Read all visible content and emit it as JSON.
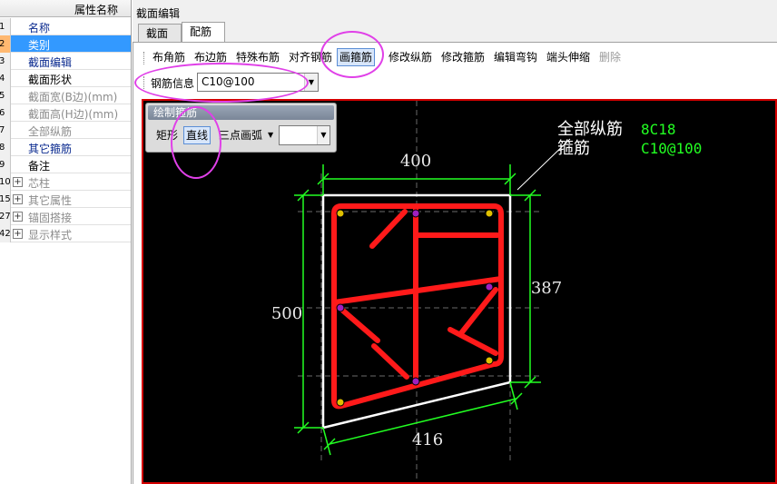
{
  "property_panel": {
    "header": "属性名称",
    "rows": [
      {
        "num": "1",
        "label": "名称",
        "color": "blue",
        "expand": false,
        "selected": false
      },
      {
        "num": "2",
        "label": "类别",
        "color": "white",
        "expand": false,
        "selected": true
      },
      {
        "num": "3",
        "label": "截面编辑",
        "color": "blue",
        "expand": false,
        "selected": false
      },
      {
        "num": "4",
        "label": "截面形状",
        "color": "black",
        "expand": false,
        "selected": false
      },
      {
        "num": "5",
        "label": "截面宽(B边)(mm)",
        "color": "gray",
        "expand": false,
        "selected": false
      },
      {
        "num": "6",
        "label": "截面高(H边)(mm)",
        "color": "gray",
        "expand": false,
        "selected": false
      },
      {
        "num": "7",
        "label": "全部纵筋",
        "color": "gray",
        "expand": false,
        "selected": false
      },
      {
        "num": "8",
        "label": "其它箍筋",
        "color": "blue",
        "expand": false,
        "selected": false
      },
      {
        "num": "9",
        "label": "备注",
        "color": "black",
        "expand": false,
        "selected": false
      },
      {
        "num": "10",
        "label": "芯柱",
        "color": "gray",
        "expand": true,
        "selected": false
      },
      {
        "num": "15",
        "label": "其它属性",
        "color": "gray",
        "expand": true,
        "selected": false
      },
      {
        "num": "27",
        "label": "锚固搭接",
        "color": "gray",
        "expand": true,
        "selected": false
      },
      {
        "num": "42",
        "label": "显示样式",
        "color": "gray",
        "expand": true,
        "selected": false
      }
    ]
  },
  "editor": {
    "title": "截面编辑",
    "tabs": [
      "截面",
      "配筋"
    ],
    "active_tab": "配筋",
    "toolbar": [
      "布角筋",
      "布边筋",
      "特殊布筋",
      "对齐钢筋",
      "画箍筋",
      "修改纵筋",
      "修改箍筋",
      "编辑弯钩",
      "端头伸缩",
      "删除"
    ],
    "toolbar_pressed": "画箍筋",
    "toolbar_disabled": "删除",
    "rebar_info_label": "钢筋信息",
    "rebar_info_value": "C10@100"
  },
  "draw_panel": {
    "title": "绘制箍筋",
    "buttons": [
      "矩形",
      "直线",
      "三点画弧"
    ],
    "pressed": "直线",
    "combo_value": ""
  },
  "drawing": {
    "dim_top": "400",
    "dim_left": "500",
    "dim_right": "387",
    "dim_bottom": "416",
    "legend_longitudinal_label": "全部纵筋",
    "legend_longitudinal_value": "8C18",
    "legend_stirrup_label": "箍筋",
    "legend_stirrup_value": "C10@100"
  },
  "colors": {
    "selection": "#3399ff",
    "canvas_bg": "#000000",
    "canvas_border": "#d40000",
    "rebar": "#ff1a1a",
    "dimension": "#22ff22",
    "annotation_ring": "#e040e8",
    "legend_value": "#22ff22"
  }
}
